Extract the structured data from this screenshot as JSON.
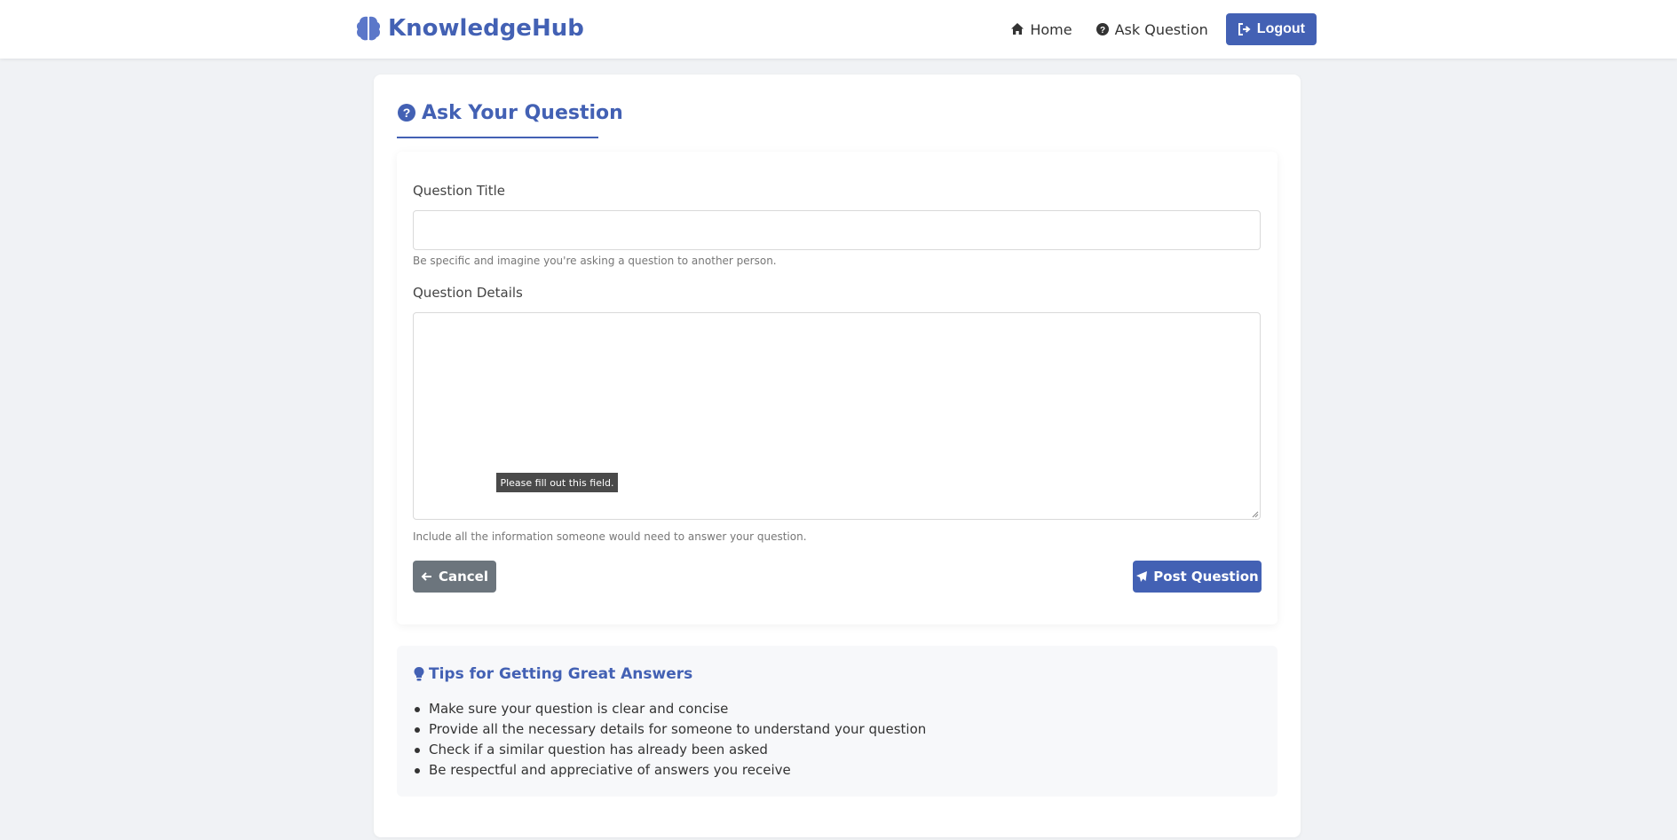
{
  "navbar": {
    "brand": "KnowledgeHub",
    "links": [
      {
        "label": "Home",
        "icon": "home-icon"
      },
      {
        "label": "Ask Question",
        "icon": "question-circle-icon"
      }
    ],
    "logout_label": "Logout"
  },
  "page": {
    "title": "Ask Your Question"
  },
  "form": {
    "title_label": "Question Title",
    "title_value": "",
    "title_help": "Be specific and imagine you're asking a question to another person.",
    "details_label": "Question Details",
    "details_value": "",
    "details_help": "Include all the information someone would need to answer your question.",
    "validation_tooltip": "Please fill out this field.",
    "cancel_label": "Cancel",
    "post_label": "Post Question"
  },
  "tips": {
    "title": "Tips for Getting Great Answers",
    "items": [
      "Make sure your question is clear and concise",
      "Provide all the necessary details for someone to understand your question",
      "Check if a similar question has already been asked",
      "Be respectful and appreciative of answers you receive"
    ]
  },
  "colors": {
    "accent": "#4361b4",
    "cancel": "#6c757d",
    "background": "#f0f2f5",
    "tips_background": "#f7f8fa"
  }
}
